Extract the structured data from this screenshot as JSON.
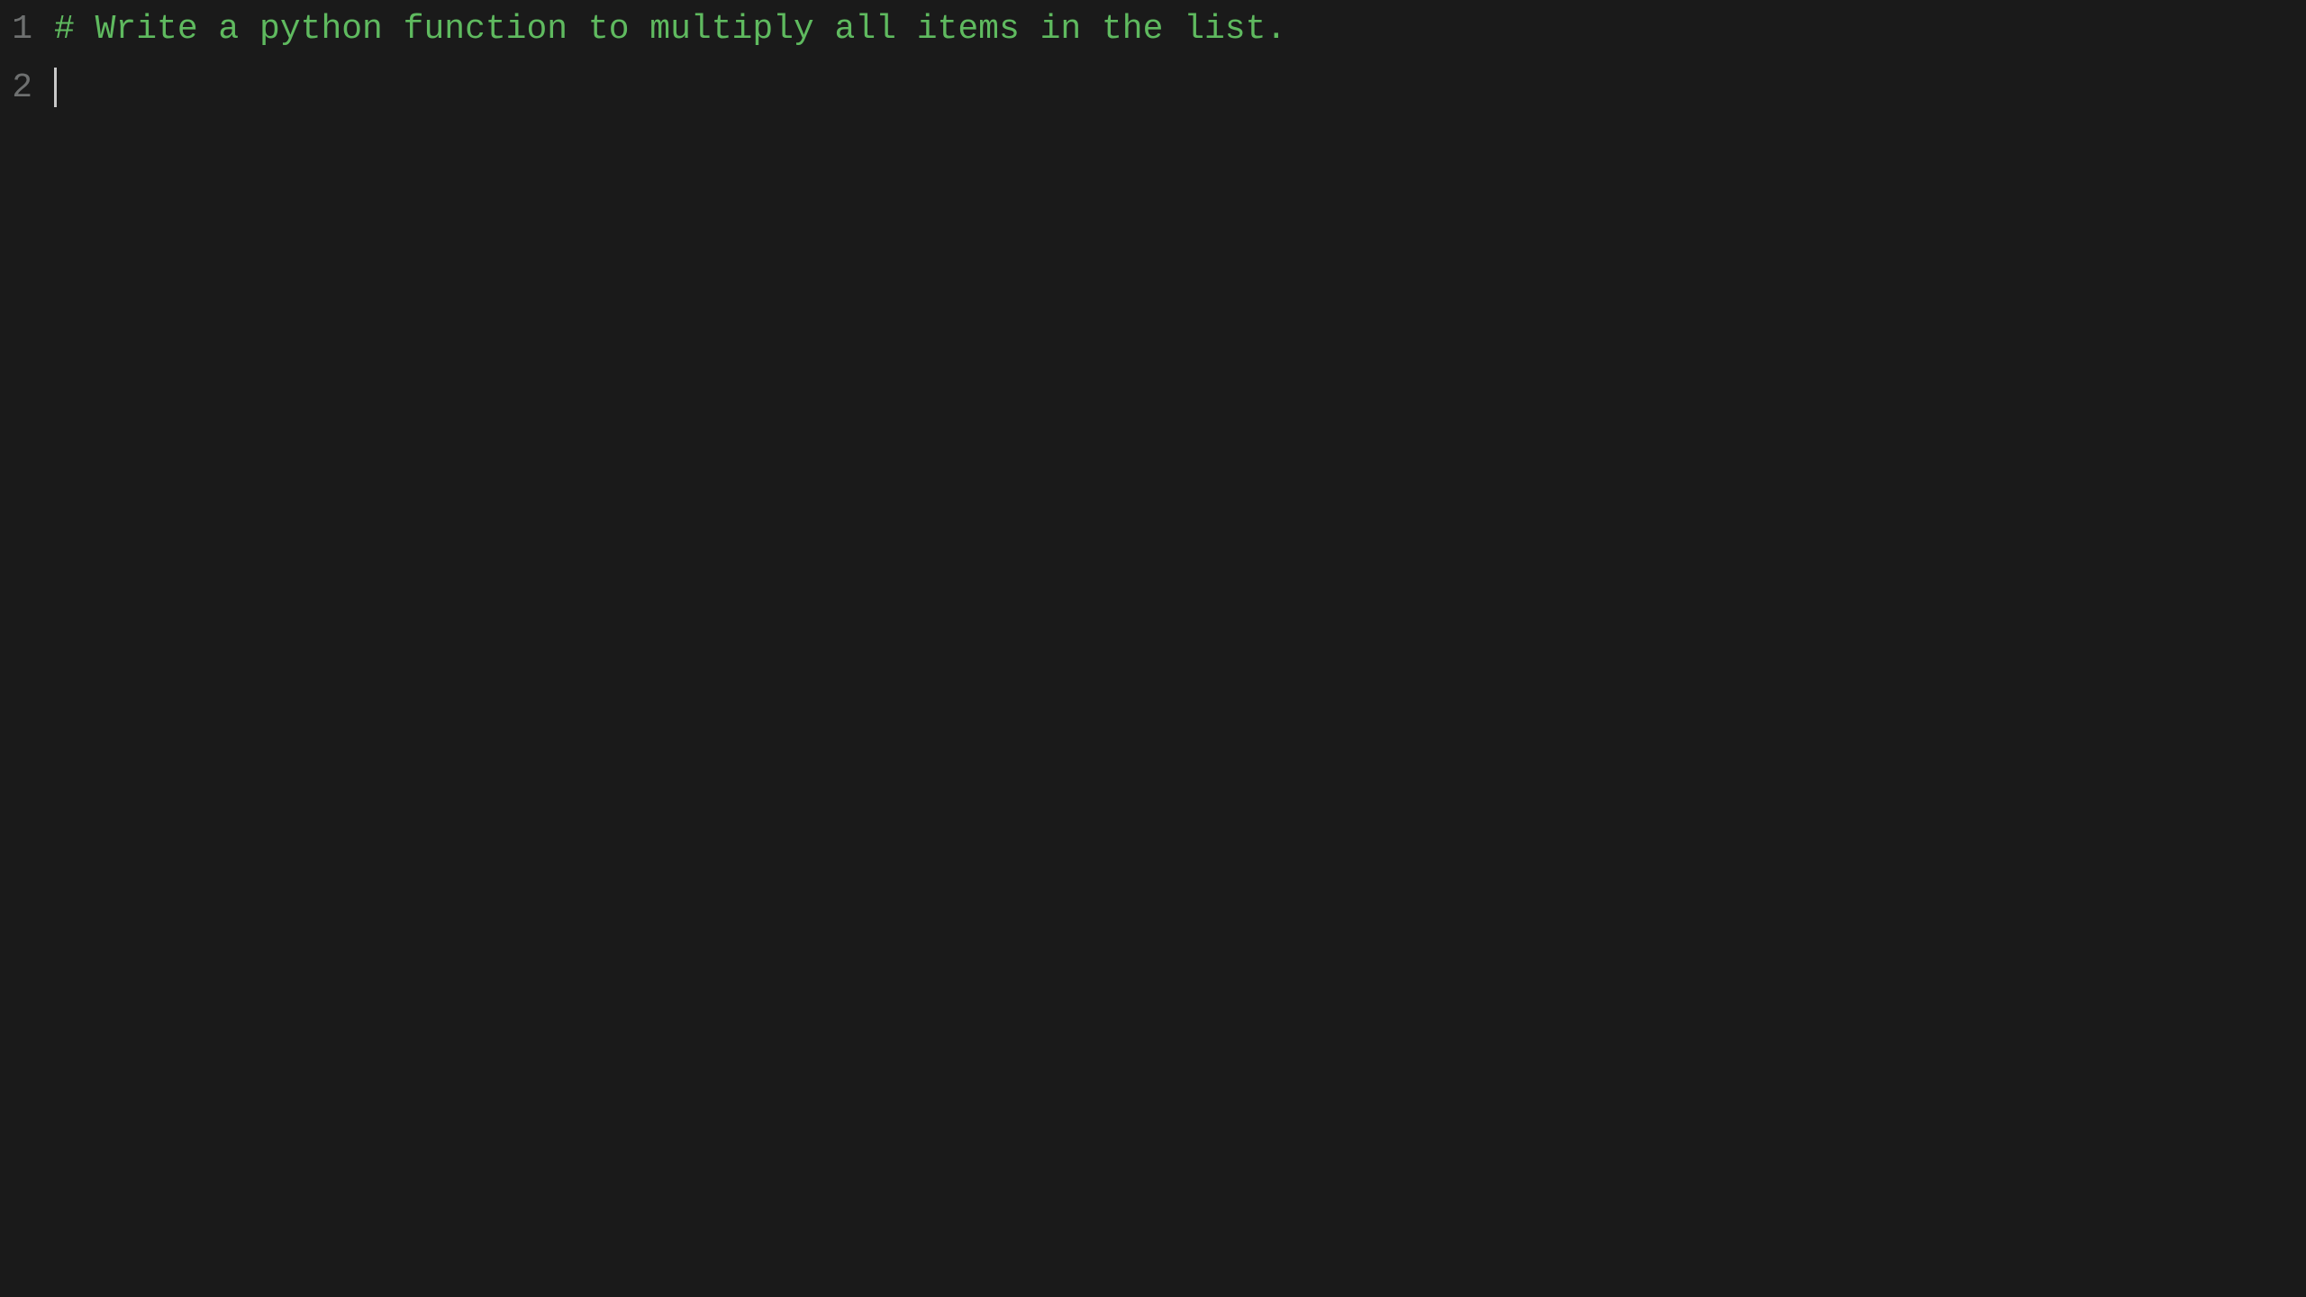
{
  "editor": {
    "background": "#1a1a1a",
    "lines": [
      {
        "number": "1",
        "content": "# Write a python function to multiply all items in the list.",
        "has_cursor": false
      },
      {
        "number": "2",
        "content": "",
        "has_cursor": true
      }
    ]
  }
}
